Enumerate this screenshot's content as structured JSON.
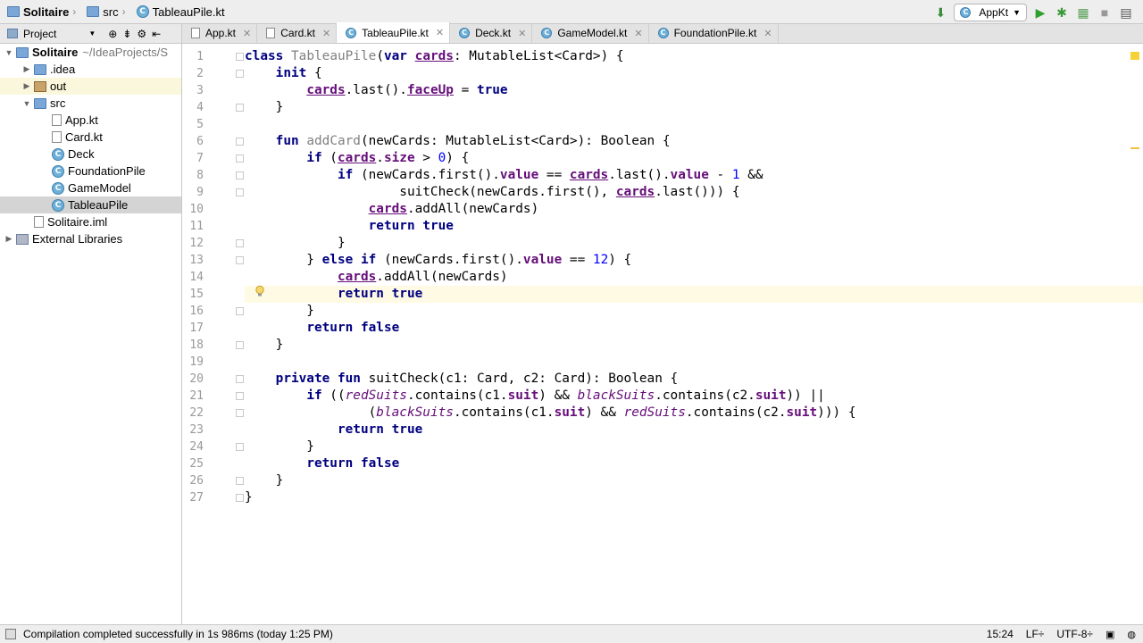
{
  "breadcrumb": {
    "project": "Solitaire",
    "folder": "src",
    "file": "TableauPile.kt"
  },
  "run_config": {
    "name": "AppKt"
  },
  "sidebar": {
    "header": "Project",
    "tree": [
      {
        "name": "Solitaire",
        "suffix": "~/IdeaProjects/S",
        "indent": 0,
        "kind": "module",
        "arrow": "down"
      },
      {
        "name": ".idea",
        "indent": 1,
        "kind": "folder",
        "arrow": "right"
      },
      {
        "name": "out",
        "indent": 1,
        "kind": "folder-brown",
        "arrow": "right"
      },
      {
        "name": "src",
        "indent": 1,
        "kind": "folder",
        "arrow": "down"
      },
      {
        "name": "App.kt",
        "indent": 2,
        "kind": "file"
      },
      {
        "name": "Card.kt",
        "indent": 2,
        "kind": "file"
      },
      {
        "name": "Deck",
        "indent": 2,
        "kind": "class"
      },
      {
        "name": "FoundationPile",
        "indent": 2,
        "kind": "class"
      },
      {
        "name": "GameModel",
        "indent": 2,
        "kind": "class"
      },
      {
        "name": "TableauPile",
        "indent": 2,
        "kind": "class",
        "selected": true
      },
      {
        "name": "Solitaire.iml",
        "indent": 1,
        "kind": "file"
      },
      {
        "name": "External Libraries",
        "indent": 0,
        "kind": "lib",
        "arrow": "right"
      }
    ]
  },
  "tabs": [
    {
      "label": "App.kt",
      "active": false
    },
    {
      "label": "Card.kt",
      "active": false
    },
    {
      "label": "TableauPile.kt",
      "active": true
    },
    {
      "label": "Deck.kt",
      "active": false
    },
    {
      "label": "GameModel.kt",
      "active": false
    },
    {
      "label": "FoundationPile.kt",
      "active": false
    }
  ],
  "editor": {
    "current_line": 15,
    "lines": [
      "class TableauPile(var cards: MutableList<Card>) {",
      "    init {",
      "        cards.last().faceUp = true",
      "    }",
      "",
      "    fun addCard(newCards: MutableList<Card>): Boolean {",
      "        if (cards.size > 0) {",
      "            if (newCards.first().value == cards.last().value - 1 &&",
      "                    suitCheck(newCards.first(), cards.last())) {",
      "                cards.addAll(newCards)",
      "                return true",
      "            }",
      "        } else if (newCards.first().value == 12) {",
      "            cards.addAll(newCards)",
      "            return true",
      "        }",
      "        return false",
      "    }",
      "",
      "    private fun suitCheck(c1: Card, c2: Card): Boolean {",
      "        if ((redSuits.contains(c1.suit) && blackSuits.contains(c2.suit)) ||",
      "                (blackSuits.contains(c1.suit) && redSuits.contains(c2.suit))) {",
      "            return true",
      "        }",
      "        return false",
      "    }",
      "}"
    ]
  },
  "status": {
    "message": "Compilation completed successfully in 1s 986ms (today 1:25 PM)",
    "position": "15:24",
    "line_sep": "LF÷",
    "encoding": "UTF-8÷"
  },
  "colors": {
    "keyword": "#000080",
    "property": "#660e7a",
    "number": "#0000ff",
    "caret_line": "#fffae3",
    "selection": "#d4d4d4"
  }
}
